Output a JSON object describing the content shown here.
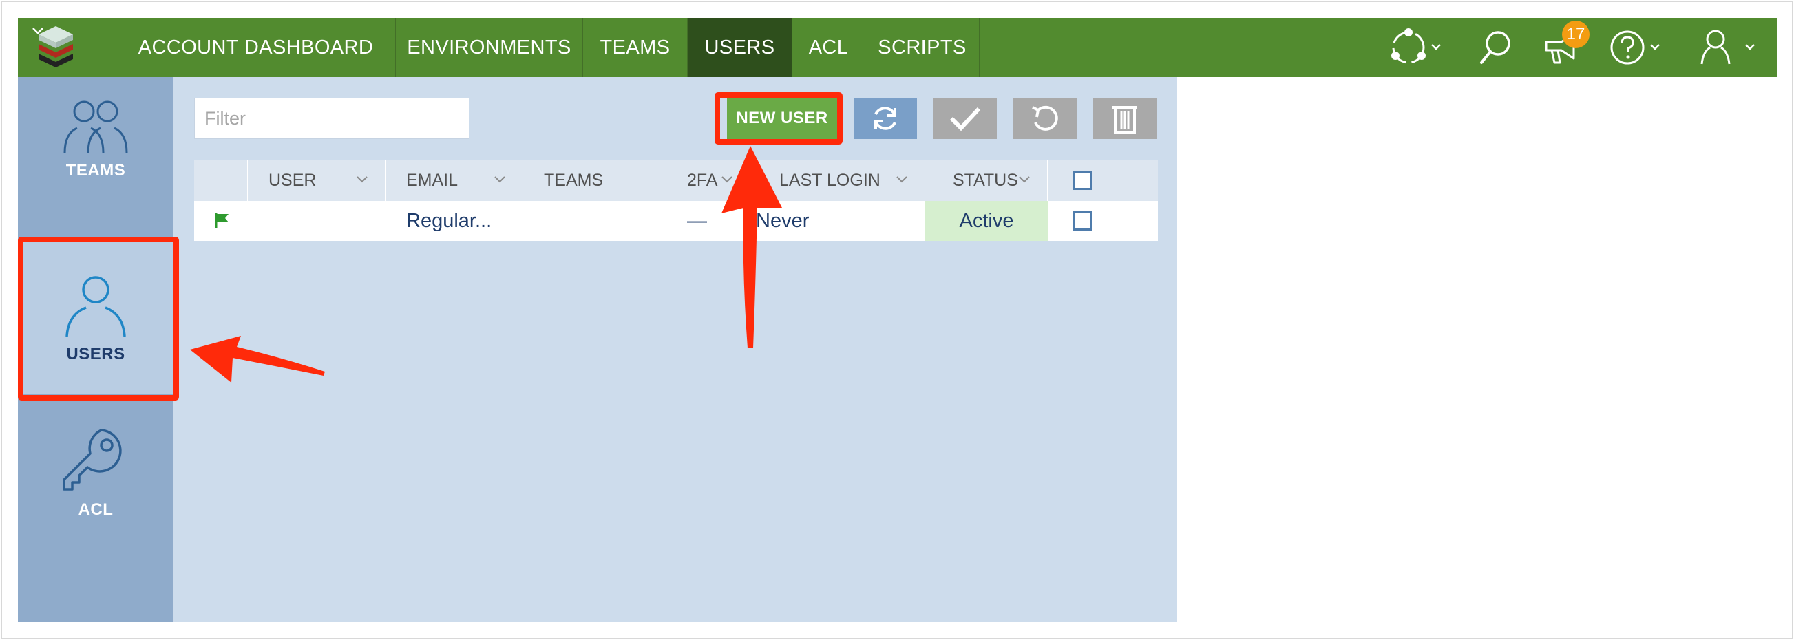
{
  "nav": {
    "items": [
      {
        "label": "ACCOUNT DASHBOARD",
        "active": false
      },
      {
        "label": "ENVIRONMENTS",
        "active": false
      },
      {
        "label": "TEAMS",
        "active": false
      },
      {
        "label": "USERS",
        "active": true
      },
      {
        "label": "ACL",
        "active": false
      },
      {
        "label": "SCRIPTS",
        "active": false
      }
    ],
    "notifications_count": "17",
    "icons": [
      "logo-icon",
      "network-icon",
      "search-icon",
      "announcements-icon",
      "help-icon",
      "user-icon"
    ],
    "brand_color": "#528b2f",
    "active_color": "#2e4f1c"
  },
  "sidebar": {
    "items": [
      {
        "label": "TEAMS",
        "icon": "teams-icon",
        "active": false
      },
      {
        "label": "USERS",
        "icon": "user-icon",
        "active": true
      },
      {
        "label": "ACL",
        "icon": "key-icon",
        "active": false
      }
    ]
  },
  "toolbar": {
    "filter_placeholder": "Filter",
    "new_user_label": "NEW USER",
    "icons": [
      "refresh-icon",
      "check-icon",
      "undo-icon",
      "trash-icon"
    ]
  },
  "table": {
    "columns": [
      "USER",
      "EMAIL",
      "TEAMS",
      "2FA",
      "LAST LOGIN",
      "STATUS"
    ],
    "rows": [
      {
        "flag": "flag-icon",
        "user": "",
        "email": "Regular...",
        "teams": "",
        "twofa": "—",
        "last_login": "Never",
        "status": "Active"
      }
    ]
  },
  "annotation_color": "#ff2a0a"
}
